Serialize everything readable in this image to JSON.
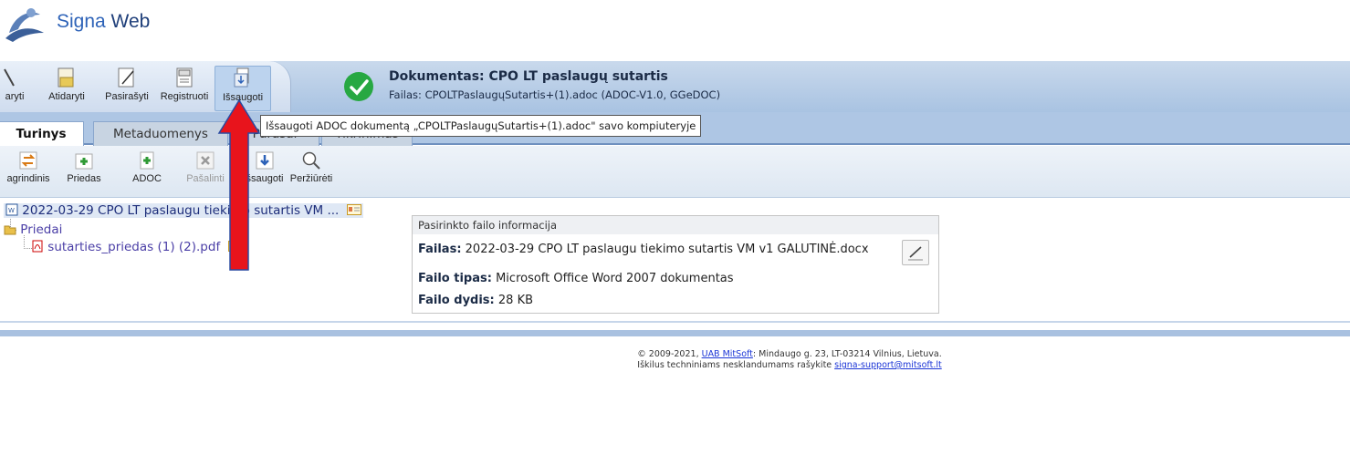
{
  "header": {
    "brand_signa": "Signa",
    "brand_web": " Web"
  },
  "toolbar": {
    "items": [
      {
        "label": "aryti"
      },
      {
        "label": "Atidaryti"
      },
      {
        "label": "Pasirašyti"
      },
      {
        "label": "Registruoti"
      },
      {
        "label": "Išsaugoti"
      }
    ]
  },
  "document": {
    "title": "Dokumentas: CPO LT paslaugų sutartis",
    "file": "Failas: CPOLTPaslaugųSutartis+(1).adoc (ADOC-V1.0, GGeDOC)"
  },
  "tooltip": "Išsaugoti ADOC dokumentą „CPOLTPaslaugųSutartis+(1).adoc\" savo kompiuteryje",
  "tabs": [
    {
      "label": "Turinys"
    },
    {
      "label": "Metaduomenys"
    },
    {
      "label": "Parašai"
    },
    {
      "label": "Tikrinimas"
    }
  ],
  "subtoolbar": {
    "items": [
      {
        "label": "agrindinis"
      },
      {
        "label": "Priedas"
      },
      {
        "label": "ADOC"
      },
      {
        "label": "Pašalinti"
      },
      {
        "label": "šsaugoti"
      },
      {
        "label": "Peržiūrėti"
      }
    ]
  },
  "tree": {
    "root": "2022-03-29 CPO LT paslaugu tiekimo sutartis VM ...",
    "folder": "Priedai",
    "attachment": "sutarties_priedas (1) (2).pdf"
  },
  "info_panel": {
    "heading": "Pasirinkto failo informacija",
    "file_label": "Failas:",
    "file_value": "2022-03-29 CPO LT paslaugu tiekimo sutartis VM v1 GALUTINĖ.docx",
    "type_label": "Failo tipas:",
    "type_value": "Microsoft Office Word 2007 dokumentas",
    "size_label": "Failo dydis:",
    "size_value": "28 KB"
  },
  "footer": {
    "line1_pre": "© 2009-2021, ",
    "line1_link": "UAB MitSoft",
    "line1_post": ": Mindaugo g. 23, LT-03214 Vilnius, Lietuva.",
    "line2_pre": "Iškilus techniniams nesklandumams rašykite ",
    "line2_link": "signa-support@mitsoft.lt"
  },
  "colors": {
    "accent": "#2e63b8",
    "toolbar": "#a9c3e2",
    "ok_green": "#27a842",
    "arrow_red": "#e8141c"
  }
}
